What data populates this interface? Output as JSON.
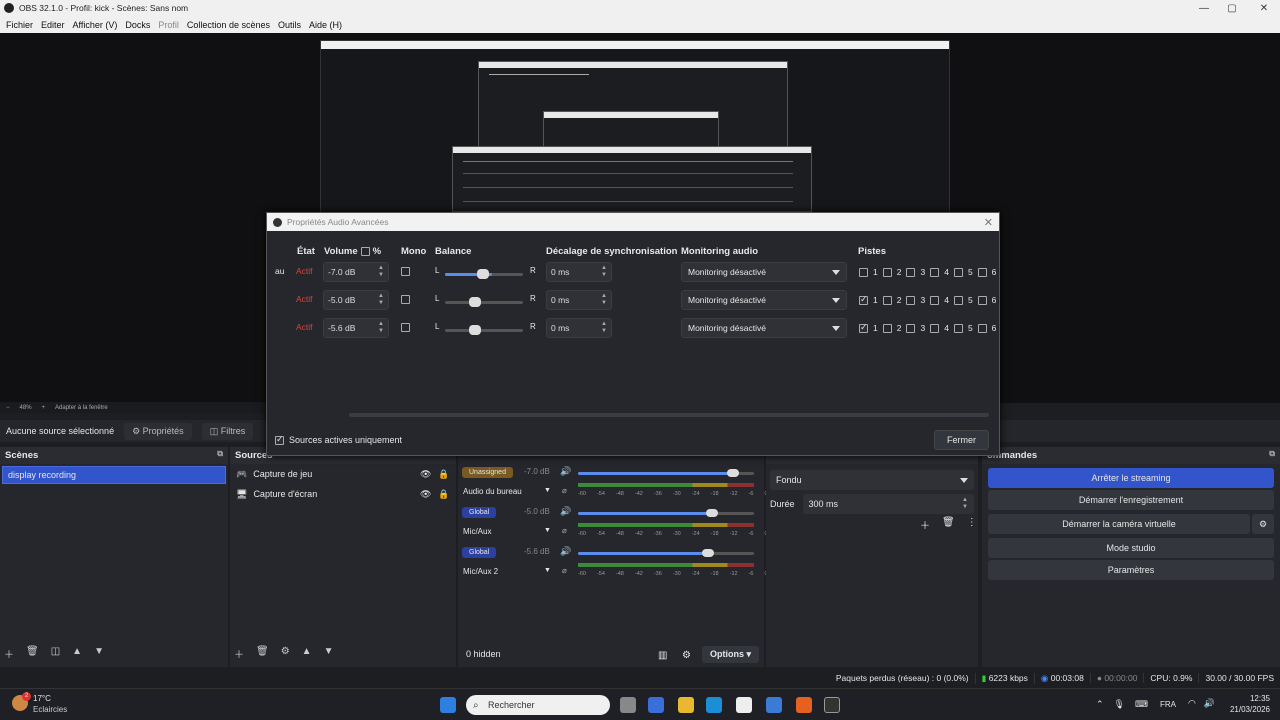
{
  "window": {
    "title": "OBS 32.1.0 - Profil: kick - Scènes: Sans nom"
  },
  "menu": [
    "Fichier",
    "Editer",
    "Afficher (V)",
    "Docks",
    "Profil",
    "Collection de scènes",
    "Outils",
    "Aide (H)"
  ],
  "preview": {
    "zoom": "48%",
    "fit": "Adapter à la fenêtre"
  },
  "source_bar": {
    "no_source": "Aucune source sélectionné",
    "properties": "Propriétés",
    "filters": "Filtres"
  },
  "dialog": {
    "title": "Propriétés Audio Avancées",
    "headers": {
      "state": "État",
      "volume": "Volume",
      "percent": "%",
      "mono": "Mono",
      "balance": "Balance",
      "sync": "Décalage de synchronisation",
      "monitoring": "Monitoring audio",
      "tracks": "Pistes"
    },
    "rows": [
      {
        "name": "au",
        "state": "Actif",
        "volume": "-7.0 dB",
        "balance_l": "L",
        "balance_r": "R",
        "balance_level": 0.6,
        "sync": "0 ms",
        "monitoring": "Monitoring désactivé",
        "tracks": [
          false,
          false,
          false,
          false,
          false,
          false
        ]
      },
      {
        "name": "",
        "state": "Actif",
        "volume": "-5.0 dB",
        "balance_l": "L",
        "balance_r": "R",
        "balance_level": 0.5,
        "sync": "0 ms",
        "monitoring": "Monitoring désactivé",
        "tracks": [
          true,
          false,
          false,
          false,
          false,
          false
        ]
      },
      {
        "name": "",
        "state": "Actif",
        "volume": "-5.6 dB",
        "balance_l": "L",
        "balance_r": "R",
        "balance_level": 0.5,
        "sync": "0 ms",
        "monitoring": "Monitoring désactivé",
        "tracks": [
          true,
          false,
          false,
          false,
          false,
          false
        ]
      }
    ],
    "track_labels": [
      "1",
      "2",
      "3",
      "4",
      "5",
      "6"
    ],
    "active_only": "Sources actives uniquement",
    "close": "Fermer"
  },
  "scenes": {
    "title": "Scènes",
    "items": [
      "display recording"
    ]
  },
  "sources": {
    "title": "Sources",
    "items": [
      "Capture de jeu",
      "Capture d'écran"
    ]
  },
  "mixer": {
    "channels": [
      {
        "badge": "Unassigned",
        "db": "-7.0 dB",
        "name": "Audio du bureau",
        "level": 0.88
      },
      {
        "badge": "Global",
        "db": "-5.0 dB",
        "name": "Mic/Aux",
        "level": 0.76
      },
      {
        "badge": "Global",
        "db": "-5.6 dB",
        "name": "Mic/Aux 2",
        "level": 0.74
      }
    ],
    "scale": [
      "-60",
      "-54",
      "-48",
      "-42",
      "-36",
      "-30",
      "-24",
      "-18",
      "-12",
      "-6",
      "0"
    ],
    "hidden": "0 hidden",
    "options": "Options"
  },
  "transitions": {
    "type": "Fondu",
    "duration_label": "Durée",
    "duration": "300 ms"
  },
  "controls": {
    "title": "ommandes",
    "buttons": [
      "Arrêter le streaming",
      "Démarrer l'enregistrement",
      "Démarrer la caméra virtuelle",
      "Mode studio",
      "Paramètres"
    ]
  },
  "status": {
    "dropped": "Paquets perdus (réseau) : 0 (0.0%)",
    "bitrate": "6223 kbps",
    "stream_time": "00:03:08",
    "rec_time": "00:00:00",
    "cpu": "CPU: 0.9%",
    "fps": "30.00 / 30.00 FPS"
  },
  "taskbar": {
    "weather_temp": "17°C",
    "weather_text": "Eclaircies",
    "weather_badge": "2",
    "search": "Rechercher",
    "lang": "FRA",
    "time": "12:35",
    "date": "21/03/2026"
  }
}
